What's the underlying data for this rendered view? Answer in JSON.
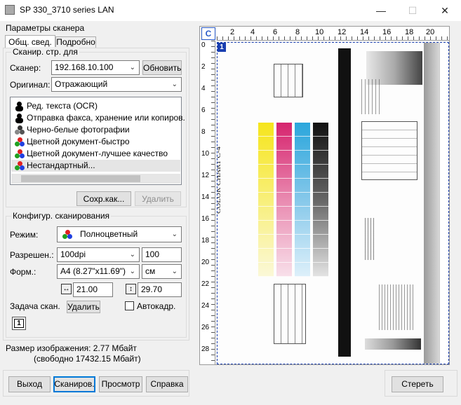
{
  "window": {
    "title": "SP 330_3710 series LAN"
  },
  "settings_label": "Параметры сканера",
  "tabs": [
    {
      "label": "Общ. свед."
    },
    {
      "label": "Подробно"
    }
  ],
  "scan_for": {
    "group_label": "Сканир. стр. для",
    "scanner_label": "Сканер:",
    "scanner_value": "192.168.10.100",
    "refresh_label": "Обновить",
    "original_label": "Оригинал:",
    "original_value": "Отражающий",
    "presets": [
      {
        "label": "Ред. текста (OCR)",
        "icon": "bw-figure-icon"
      },
      {
        "label": "Отправка факса, хранение или копиров.",
        "icon": "bw-figure-icon"
      },
      {
        "label": "Черно-белые фотографии",
        "icon": "grayscale-circles-icon"
      },
      {
        "label": "Цветной документ-быстро",
        "icon": "color-circles-icon"
      },
      {
        "label": "Цветной документ-лучшее качество",
        "icon": "color-circles-icon"
      },
      {
        "label": "Нестандартный...",
        "icon": "color-circles-icon"
      }
    ],
    "save_as_label": "Сохр.как...",
    "delete_label": "Удалить"
  },
  "config": {
    "group_label": "Конфигур. сканирования",
    "mode_label": "Режим:",
    "mode_value": "Полноцветный",
    "resolution_label": "Разрешен.:",
    "resolution_value": "100dpi",
    "resolution_input": "100",
    "format_label": "Форм.:",
    "format_value": "A4 (8.27\"x11.69\")",
    "unit_value": "см",
    "width_value": "21.00",
    "height_value": "29.70",
    "task_label": "Задача скан.",
    "task_delete_label": "Удалить",
    "autoframe_label": "Автокадр.",
    "frame_number": "1"
  },
  "image_size": {
    "line1": "Размер изображения: 2.77 Мбайт",
    "line2": "(свободно 17432.15 Мбайт)"
  },
  "buttons": {
    "exit": "Выход",
    "scan": "Сканиров.",
    "preview": "Просмотр",
    "help": "Справка",
    "clear": "Стереть"
  },
  "preview": {
    "ruler_top": [
      "2",
      "4",
      "6",
      "8",
      "10",
      "12",
      "14",
      "16",
      "18",
      "20"
    ],
    "ruler_left": [
      "0",
      "2",
      "4",
      "6",
      "8",
      "10",
      "12",
      "14",
      "16",
      "18",
      "20",
      "22",
      "24",
      "26",
      "28"
    ],
    "frame_badge": "1",
    "chart_title": "COLOR CHART C-4"
  },
  "colors": {
    "accent": "#0078d7",
    "cyan": "#2aa6dc",
    "magenta": "#d6246e",
    "yellow": "#f6e51c"
  }
}
